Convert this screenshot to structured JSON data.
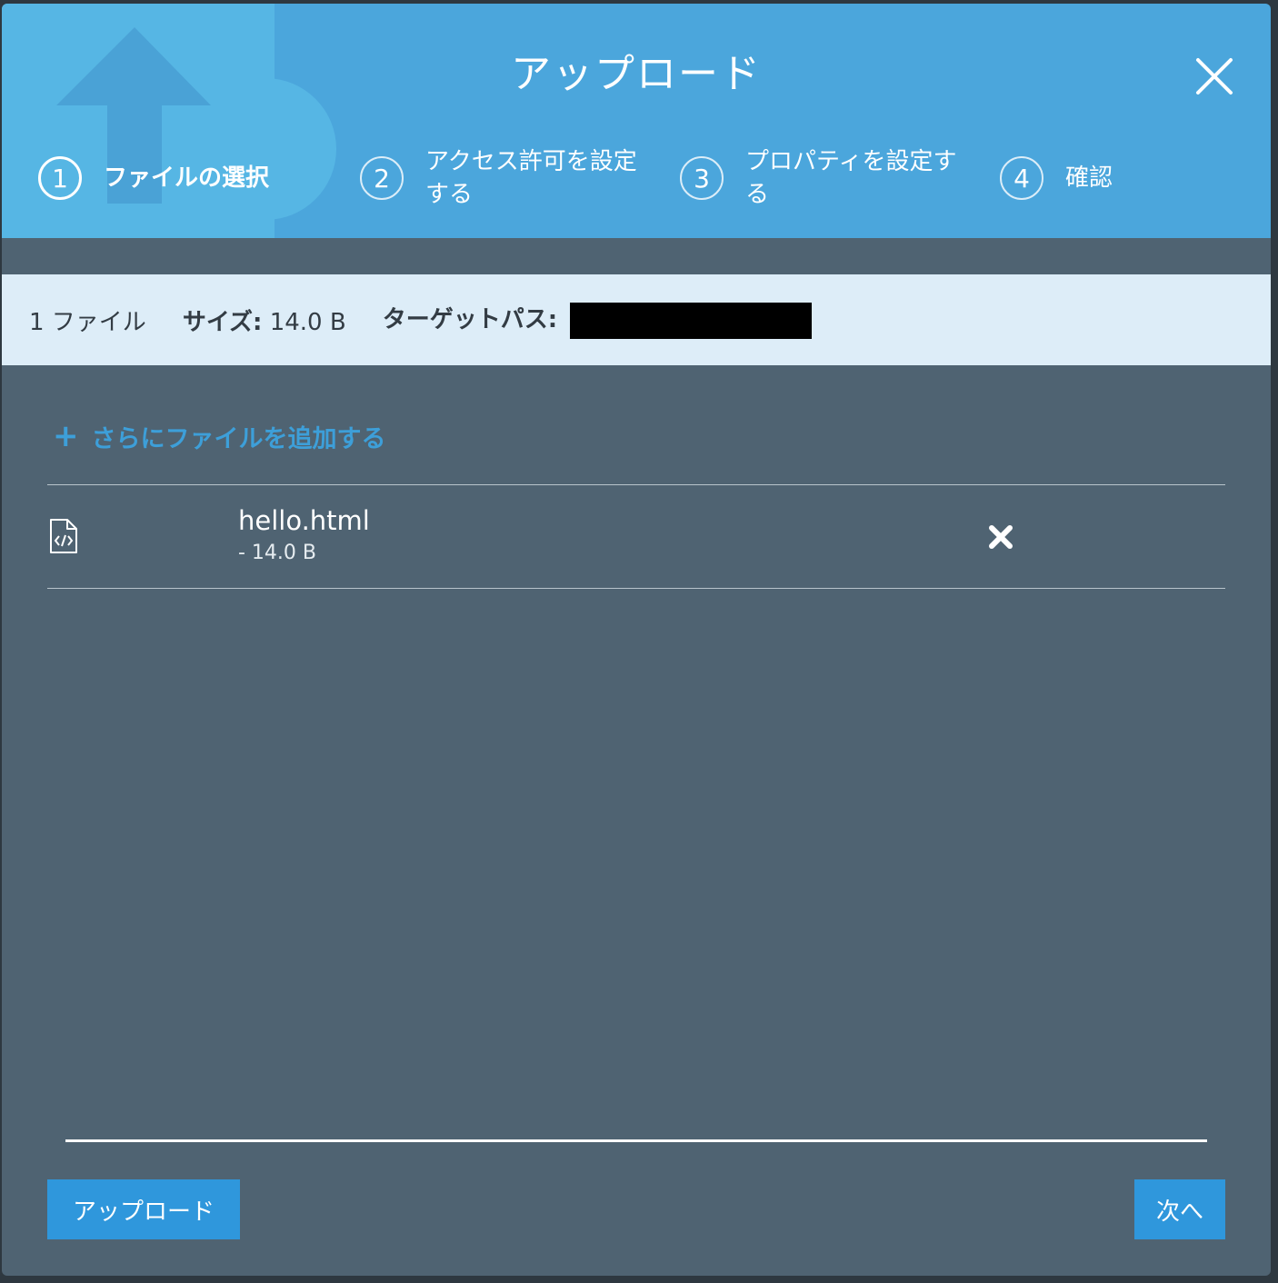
{
  "dialog": {
    "title": "アップロード",
    "close_icon": "close-icon"
  },
  "steps": [
    {
      "number": "1",
      "label": "ファイルの選択",
      "active": true
    },
    {
      "number": "2",
      "label": "アクセス許可を設定する",
      "active": false
    },
    {
      "number": "3",
      "label": "プロパティを設定する",
      "active": false
    },
    {
      "number": "4",
      "label": "確認",
      "active": false
    }
  ],
  "summary": {
    "file_count": "1 ファイル",
    "size_label": "サイズ:",
    "size_value": "14.0 B",
    "target_label": "ターゲットパス:"
  },
  "add_files": {
    "icon": "plus-icon",
    "label": "さらにファイルを追加する"
  },
  "files": [
    {
      "icon": "html-file-icon",
      "name": "hello.html",
      "size": "- 14.0 B",
      "remove_icon": "remove-icon"
    }
  ],
  "footer": {
    "upload_label": "アップロード",
    "next_label": "次へ"
  },
  "colors": {
    "header": "#4ba6dc",
    "body": "#4f6372",
    "accent": "#2f97dc",
    "link": "#3d9fd9",
    "infobar": "#ddedf8"
  }
}
